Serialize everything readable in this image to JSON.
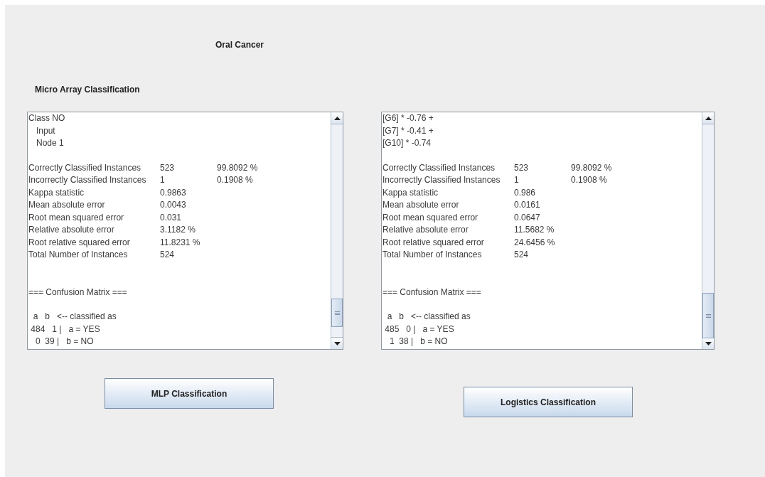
{
  "title": "Oral Cancer",
  "section_title": "Micro Array Classification",
  "panels": [
    {
      "blocks": [
        [
          {
            "kind": "text",
            "text": "Class NO"
          },
          {
            "kind": "indented",
            "text": "Input"
          },
          {
            "kind": "indented",
            "text": "Node 1"
          }
        ],
        [
          {
            "kind": "stat",
            "cells": [
              "Correctly Classified Instances",
              "523",
              "99.8092 %"
            ]
          },
          {
            "kind": "stat",
            "cells": [
              "Incorrectly Classified Instances",
              "1",
              "0.1908 %"
            ]
          },
          {
            "kind": "stat",
            "cells": [
              "Kappa statistic",
              "0.9863"
            ]
          },
          {
            "kind": "stat",
            "cells": [
              "Mean absolute error",
              "0.0043"
            ]
          },
          {
            "kind": "stat",
            "cells": [
              "Root mean squared error",
              "0.031"
            ]
          },
          {
            "kind": "stat",
            "cells": [
              "Relative absolute error",
              "3.1182 %"
            ]
          },
          {
            "kind": "stat",
            "cells": [
              "Root relative squared error",
              "11.8231 %"
            ]
          },
          {
            "kind": "stat",
            "cells": [
              "Total Number of Instances",
              "524"
            ]
          }
        ],
        [
          {
            "kind": "text",
            "text": "=== Confusion Matrix ==="
          }
        ],
        [
          {
            "kind": "text",
            "text": "  a   b   <-- classified as"
          },
          {
            "kind": "text",
            "text": " 484   1 |   a = YES"
          },
          {
            "kind": "text",
            "text": "   0  39 |   b = NO"
          }
        ]
      ],
      "button": "MLP Classification"
    },
    {
      "blocks": [
        [
          {
            "kind": "text",
            "text": "[G6] * -0.76 +"
          },
          {
            "kind": "text",
            "text": "[G7] * -0.41 +"
          },
          {
            "kind": "text",
            "text": "[G10] * -0.74"
          }
        ],
        [
          {
            "kind": "stat",
            "cells": [
              "Correctly Classified Instances",
              "523",
              "99.8092 %"
            ]
          },
          {
            "kind": "stat",
            "cells": [
              "Incorrectly Classified Instances",
              "1",
              "0.1908 %"
            ]
          },
          {
            "kind": "stat",
            "cells": [
              "Kappa statistic",
              "0.986"
            ]
          },
          {
            "kind": "stat",
            "cells": [
              "Mean absolute error",
              "0.0161"
            ]
          },
          {
            "kind": "stat",
            "cells": [
              "Root mean squared error",
              "0.0647"
            ]
          },
          {
            "kind": "stat",
            "cells": [
              "Relative absolute error",
              "11.5682 %"
            ]
          },
          {
            "kind": "stat",
            "cells": [
              "Root relative squared error",
              "24.6456 %"
            ]
          },
          {
            "kind": "stat",
            "cells": [
              "Total Number of Instances",
              "524"
            ]
          }
        ],
        [
          {
            "kind": "text",
            "text": "=== Confusion Matrix ==="
          }
        ],
        [
          {
            "kind": "text",
            "text": "  a   b   <-- classified as"
          },
          {
            "kind": "text",
            "text": " 485   0 |   a = YES"
          },
          {
            "kind": "text",
            "text": "   1  38 |   b = NO"
          }
        ]
      ],
      "button": "Logistics Classification"
    }
  ]
}
